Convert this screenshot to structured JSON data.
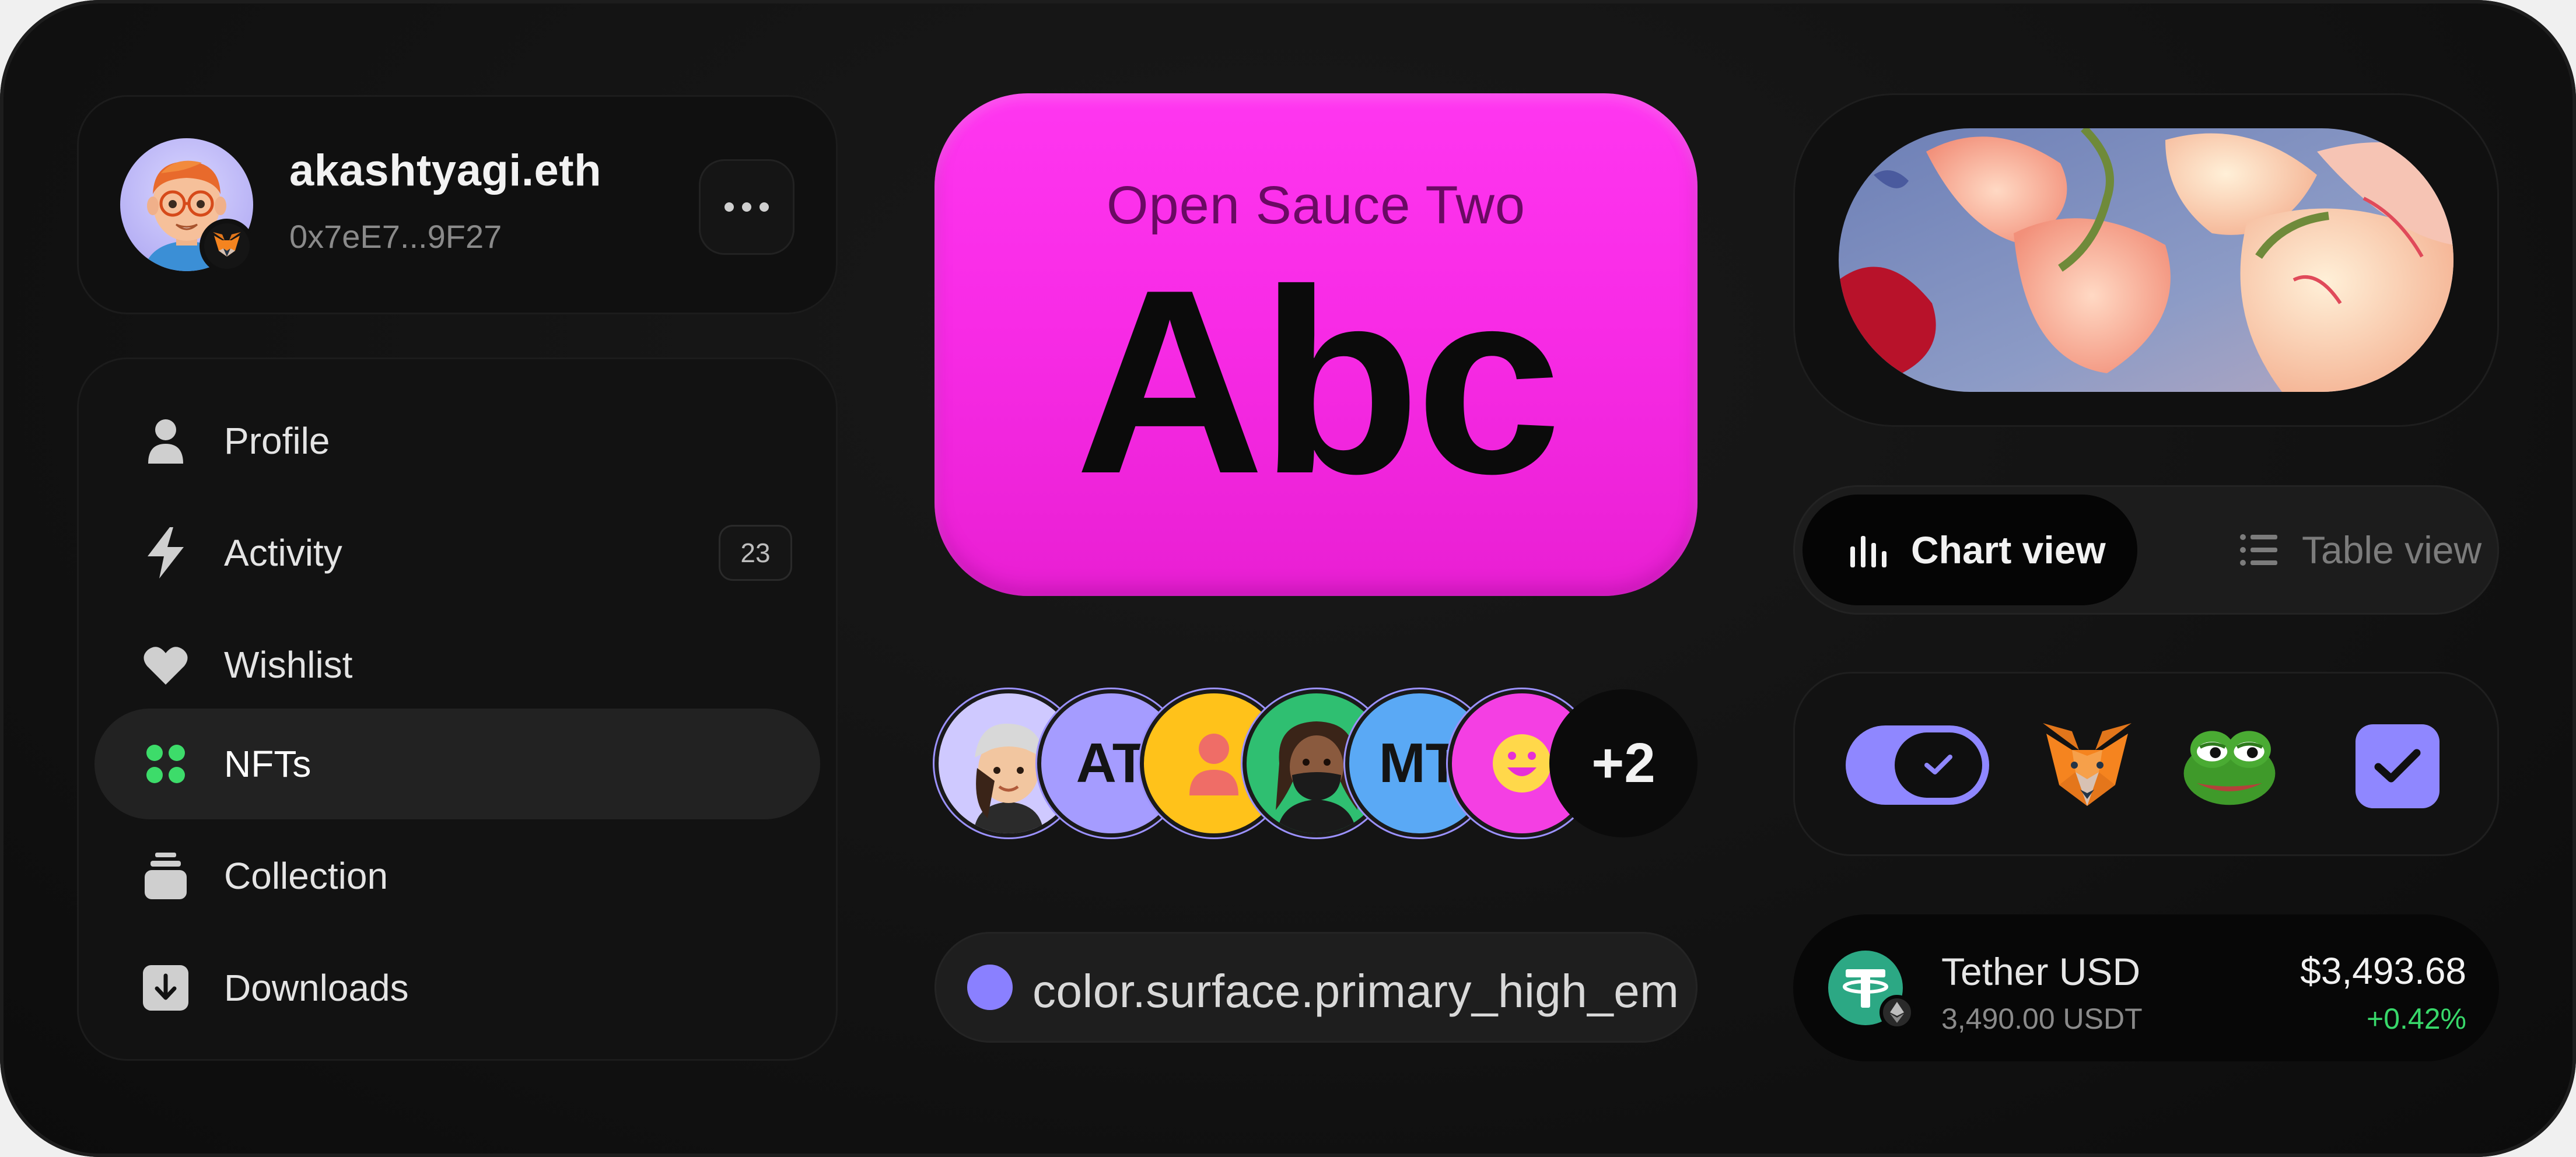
{
  "profile": {
    "username": "akashtyagi.eth",
    "address": "0x7eE7...9F27",
    "avatar_icon": "memoji-avatar-icon",
    "wallet_badge_icon": "metamask-fox-icon",
    "more_icon": "more-horizontal-icon"
  },
  "nav": {
    "items": [
      {
        "label": "Profile",
        "icon": "user-icon"
      },
      {
        "label": "Activity",
        "icon": "lightning-icon",
        "badge": "23"
      },
      {
        "label": "Wishlist",
        "icon": "heart-icon"
      },
      {
        "label": "NFTs",
        "icon": "grid-dots-icon",
        "active": true
      },
      {
        "label": "Collection",
        "icon": "stack-icon"
      },
      {
        "label": "Downloads",
        "icon": "download-icon"
      }
    ]
  },
  "font_card": {
    "font_name": "Open Sauce Two",
    "sample": "Abc",
    "color": "#f82be6"
  },
  "avatar_group": {
    "members": [
      {
        "initials": "",
        "icon": "memoji-cap-avatar-icon",
        "color": "#cfc9ff"
      },
      {
        "initials": "AT",
        "icon": "",
        "color": "#a59cff"
      },
      {
        "initials": "",
        "icon": "user-icon",
        "color": "#ffc21a"
      },
      {
        "initials": "",
        "icon": "memoji-mask-avatar-icon",
        "color": "#2fbf71"
      },
      {
        "initials": "MT",
        "icon": "",
        "color": "#5aa9f5"
      },
      {
        "initials": "",
        "icon": "smiley-icon",
        "color": "#f43fe3"
      }
    ],
    "overflow": "+2"
  },
  "token_pill": {
    "text": "color.surface.primary_high_em",
    "color": "#8a80ff"
  },
  "view_toggle": {
    "options": [
      {
        "label": "Chart view",
        "icon": "bar-chart-icon",
        "active": true
      },
      {
        "label": "Table view",
        "icon": "list-icon",
        "active": false
      }
    ]
  },
  "controls": {
    "toggle_on": true,
    "checkbox_checked": true,
    "icons": [
      "metamask-fox-icon",
      "pepe-frog-icon"
    ],
    "accent": "#8f87ff"
  },
  "asset": {
    "name": "Tether USD",
    "amount": "3,490.00 USDT",
    "value": "$3,493.68",
    "change": "+0.42%",
    "icon": "tether-icon",
    "network_icon": "ethereum-icon",
    "change_color": "#38d86a"
  }
}
